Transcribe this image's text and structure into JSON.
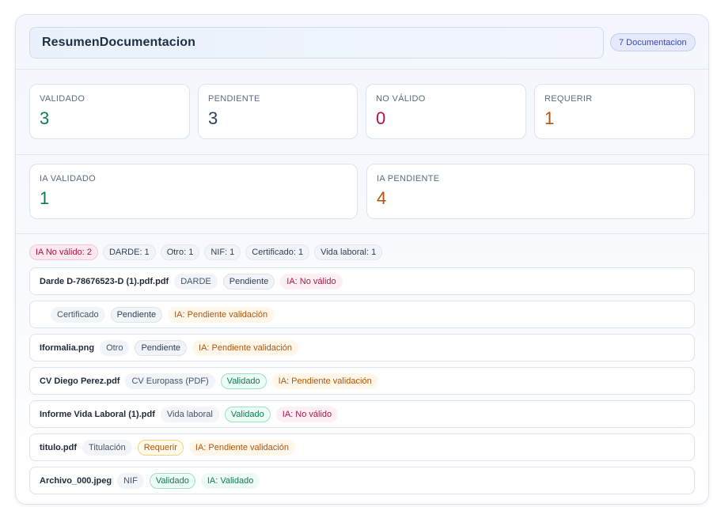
{
  "header": {
    "title": "ResumenDocumentacion",
    "count_badge": "7 Documentacion"
  },
  "stats": [
    {
      "label": "VALIDADO",
      "value": "3",
      "tone": "green"
    },
    {
      "label": "PENDIENTE",
      "value": "3",
      "tone": "slate"
    },
    {
      "label": "NO VÁLIDO",
      "value": "0",
      "tone": "red"
    },
    {
      "label": "REQUERIR",
      "value": "1",
      "tone": "orange"
    }
  ],
  "ia_stats": [
    {
      "label": "IA VALIDADO",
      "value": "1",
      "tone": "green"
    },
    {
      "label": "IA PENDIENTE",
      "value": "4",
      "tone": "orange"
    }
  ],
  "summary_chips": [
    "IA No válido: 2",
    "DARDE: 1",
    "Otro: 1",
    "NIF: 1",
    "Certificado: 1",
    "Vida laboral: 1"
  ],
  "documents": [
    {
      "name": "Darde D-78676523-D (1).pdf.pdf",
      "type": "DARDE",
      "status": "Pendiente",
      "ia": "IA: No válido"
    },
    {
      "name": "",
      "type": "Certificado",
      "status": "Pendiente",
      "ia": "IA: Pendiente validación"
    },
    {
      "name": "Iformalia.png",
      "type": "Otro",
      "status": "Pendiente",
      "ia": "IA: Pendiente validación"
    },
    {
      "name": "CV Diego Perez.pdf",
      "type": "CV Europass (PDF)",
      "status": "Validado",
      "ia": "IA: Pendiente validación"
    },
    {
      "name": "Informe Vida Laboral (1).pdf",
      "type": "Vida laboral",
      "status": "Validado",
      "ia": "IA: No válido"
    },
    {
      "name": "titulo.pdf",
      "type": "Titulación",
      "status": "Requerir",
      "ia": "IA: Pendiente validación"
    },
    {
      "name": "Archivo_000.jpeg",
      "type": "NIF",
      "status": "Validado",
      "ia": "IA: Validado"
    }
  ]
}
